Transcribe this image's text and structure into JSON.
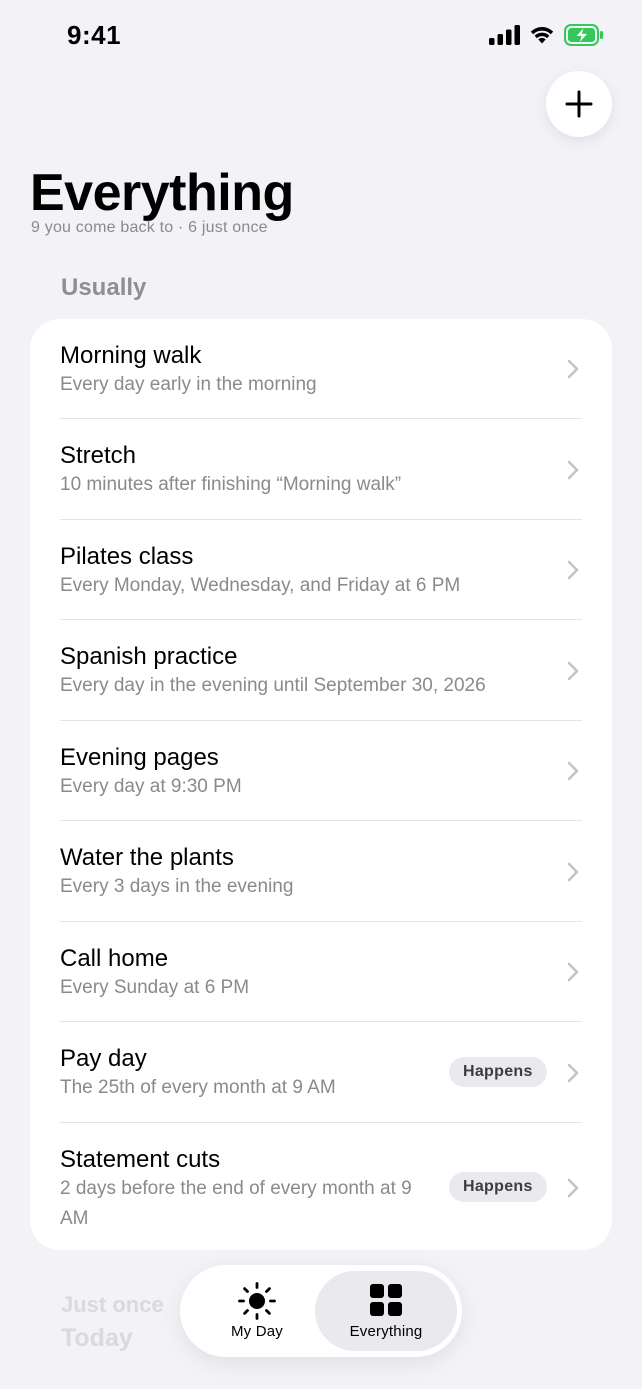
{
  "status_bar": {
    "time": "9:41"
  },
  "header": {
    "title": "Everything",
    "subtitle": "9 you come back to · 6 just once"
  },
  "sections": {
    "usually": {
      "label": "Usually",
      "items": [
        {
          "title": "Morning walk",
          "subtitle": "Every day early in the morning"
        },
        {
          "title": "Stretch",
          "subtitle": "10 minutes after finishing “Morning walk”"
        },
        {
          "title": "Pilates class",
          "subtitle": "Every Monday, Wednesday, and Friday at 6 PM"
        },
        {
          "title": "Spanish practice",
          "subtitle": "Every day in the evening until September 30, 2026"
        },
        {
          "title": "Evening pages",
          "subtitle": "Every day at 9:30 PM"
        },
        {
          "title": "Water the plants",
          "subtitle": "Every 3 days in the evening"
        },
        {
          "title": "Call home",
          "subtitle": "Every Sunday at 6 PM"
        },
        {
          "title": "Pay day",
          "subtitle": "The 25th of every month at 9 AM",
          "badge": "Happens"
        },
        {
          "title": "Statement cuts",
          "subtitle": "2 days before the end of every month at 9 AM",
          "badge": "Happens"
        }
      ]
    },
    "just_once": {
      "label": "Just once",
      "first_day": "Today"
    }
  },
  "tab_bar": {
    "tabs": [
      {
        "label": "My Day",
        "icon": "sun-icon"
      },
      {
        "label": "Everything",
        "icon": "grid-icon",
        "selected": true
      }
    ]
  },
  "colors": {
    "background": "#F2F2F7",
    "card": "#FFFFFF",
    "secondary_text": "#8A8A8E",
    "battery_green": "#34C759"
  }
}
